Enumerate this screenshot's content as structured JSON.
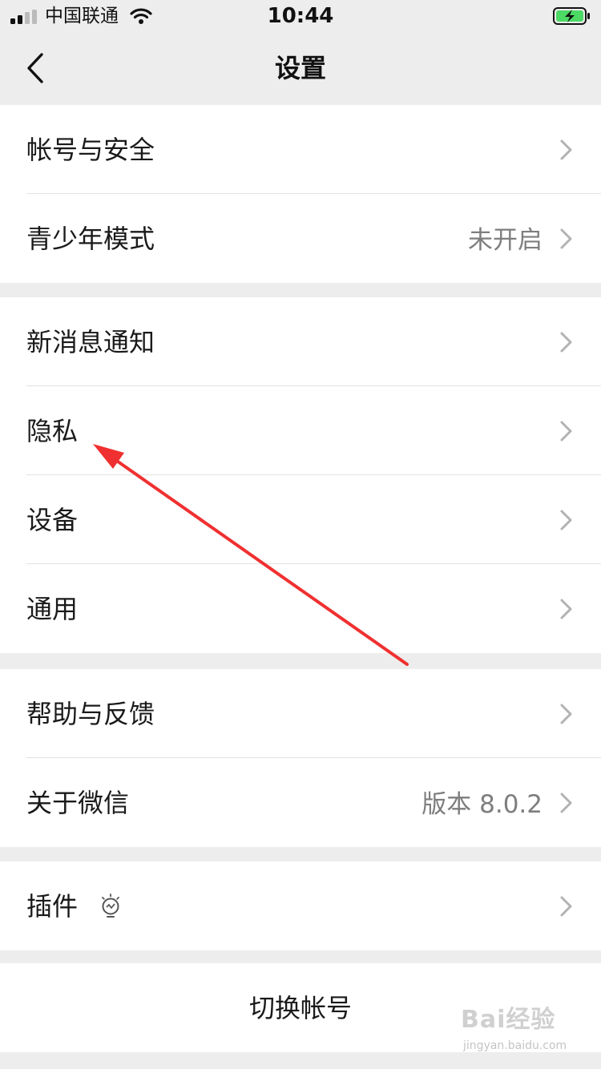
{
  "status_bar": {
    "carrier": "中国联通",
    "time": "10:44",
    "battery_color": "#4cd964"
  },
  "nav": {
    "title": "设置",
    "back_icon": "chevron-left-icon"
  },
  "groups": [
    {
      "items": [
        {
          "label": "帐号与安全",
          "value": ""
        },
        {
          "label": "青少年模式",
          "value": "未开启"
        }
      ]
    },
    {
      "items": [
        {
          "label": "新消息通知",
          "value": ""
        },
        {
          "label": "隐私",
          "value": ""
        },
        {
          "label": "设备",
          "value": ""
        },
        {
          "label": "通用",
          "value": ""
        }
      ]
    },
    {
      "items": [
        {
          "label": "帮助与反馈",
          "value": ""
        },
        {
          "label": "关于微信",
          "value": "版本 8.0.2"
        }
      ]
    },
    {
      "items": [
        {
          "label": "插件",
          "value": "",
          "icon": "plugin-bulb-icon"
        }
      ]
    }
  ],
  "switch_account": "切换帐号",
  "annotation": {
    "color": "#f03030",
    "target": "隐私"
  },
  "watermark": {
    "logo": "Bai经验",
    "url": "jingyan.baidu.com"
  }
}
